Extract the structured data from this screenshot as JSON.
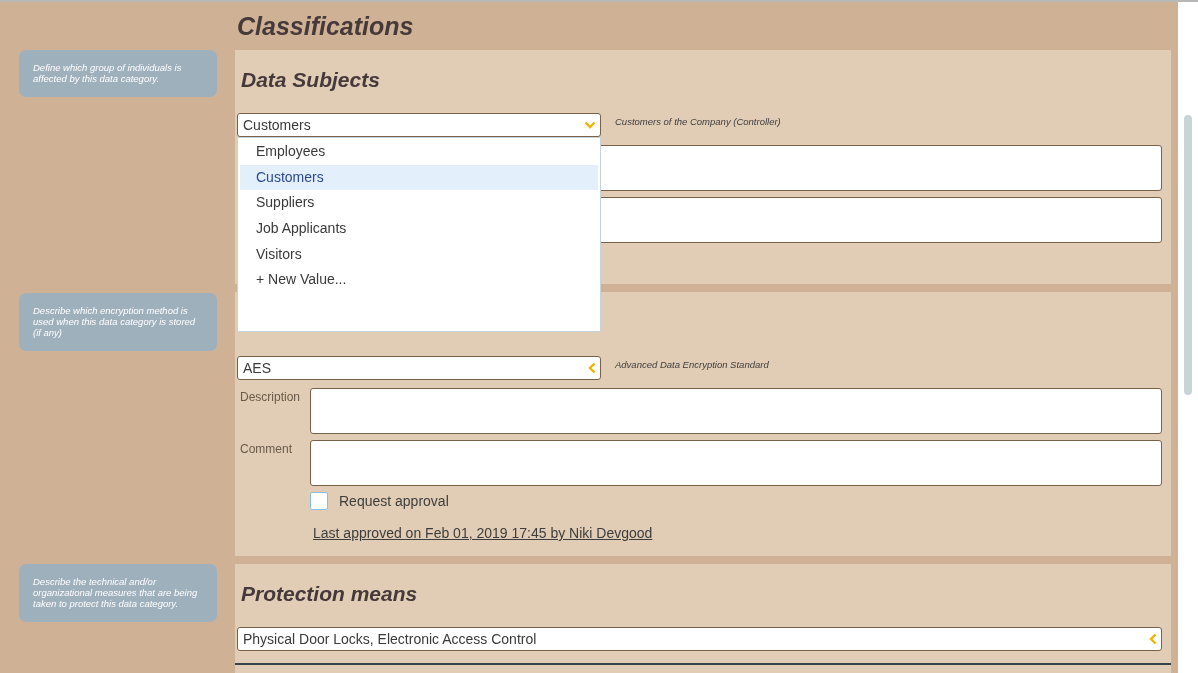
{
  "page_title": "Classifications",
  "sections": [
    {
      "help": "Define which group of individuals is affected by this data category.",
      "heading": "Data Subjects",
      "select": {
        "value": "Customers",
        "expanded": true,
        "note": "Customers of the Company (Controller)"
      },
      "options": [
        {
          "label": "Employees",
          "selected": false
        },
        {
          "label": "Customers",
          "selected": true
        },
        {
          "label": "Suppliers",
          "selected": false
        },
        {
          "label": "Job Applicants",
          "selected": false
        },
        {
          "label": "Visitors",
          "selected": false
        },
        {
          "label": "+ New Value...",
          "selected": false
        }
      ],
      "fields": [
        {
          "kind": "textarea"
        },
        {
          "kind": "textarea"
        }
      ]
    },
    {
      "help": "Describe which encryption method is used when this data category is stored (if any)",
      "select": {
        "value": "AES",
        "expanded": false,
        "note": "Advanced Data Encryption Standard"
      },
      "fields": [
        {
          "kind": "textarea",
          "label": "Description"
        },
        {
          "kind": "textarea",
          "label": "Comment"
        }
      ],
      "approval": {
        "label": "Request approval",
        "checked": false
      },
      "last_approved": "Last approved on Feb 01, 2019 17:45 by Niki Devgood"
    },
    {
      "help": "Describe the technical and/or organizational measures that are being taken to protect this data category.",
      "heading": "Protection means",
      "select": {
        "value": "Physical Door Locks, Electronic Access Control",
        "expanded": false
      }
    }
  ]
}
